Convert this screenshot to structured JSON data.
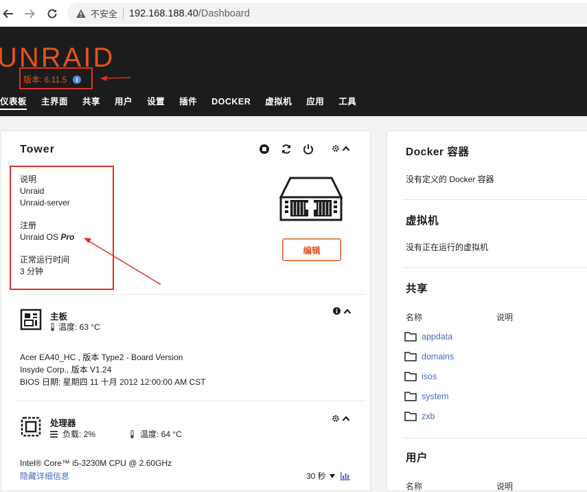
{
  "browser": {
    "insecure_label": "不安全",
    "url_host": "192.168.188.40",
    "url_path": "/Dashboard"
  },
  "header": {
    "logo": "UNRAID",
    "version": "版本: 6.11.5",
    "menu": [
      "仪表板",
      "主界面",
      "共享",
      "用户",
      "设置",
      "插件",
      "DOCKER",
      "虚拟机",
      "应用",
      "工具"
    ]
  },
  "tower": {
    "name": "Tower",
    "desc_label": "说明",
    "desc_line1": "Unraid",
    "desc_line2": "Unraid-server",
    "reg_label": "注册",
    "reg_prefix": "Unraid OS",
    "reg_edition": "Pro",
    "uptime_label": "正常运行时间",
    "uptime_value": "3 分钟",
    "edit_button": "编辑"
  },
  "motherboard": {
    "title": "主板",
    "temp": "温度: 63 °C",
    "line1": "Acer EA40_HC , 版本 Type2 - Board Version",
    "line2": "Insyde Corp., 版本 V1.24",
    "line3": "BIOS 日期: 星期四 11 十月 2012 12:00:00 AM CST"
  },
  "processor": {
    "title": "处理器",
    "load": "负载: 2%",
    "temp": "温度: 64 °C",
    "model": "Intel® Core™ i5-3230M CPU @ 2.60GHz",
    "hide_details": "隐藏详细信息",
    "interval": "30 秒"
  },
  "docker": {
    "title": "Docker 容器",
    "empty": "没有定义的 Docker 容器"
  },
  "vms": {
    "title": "虚拟机",
    "empty": "没有正在运行的虚拟机"
  },
  "shares": {
    "title": "共享",
    "col_name": "名称",
    "col_desc": "说明",
    "items": [
      "appdata",
      "domains",
      "isos",
      "system",
      "zxb"
    ]
  },
  "users": {
    "title": "用户",
    "col_name": "名称",
    "col_desc": "说明"
  },
  "colors": {
    "brand": "#e2541b",
    "link": "#486dba",
    "annotation": "#e03030"
  }
}
